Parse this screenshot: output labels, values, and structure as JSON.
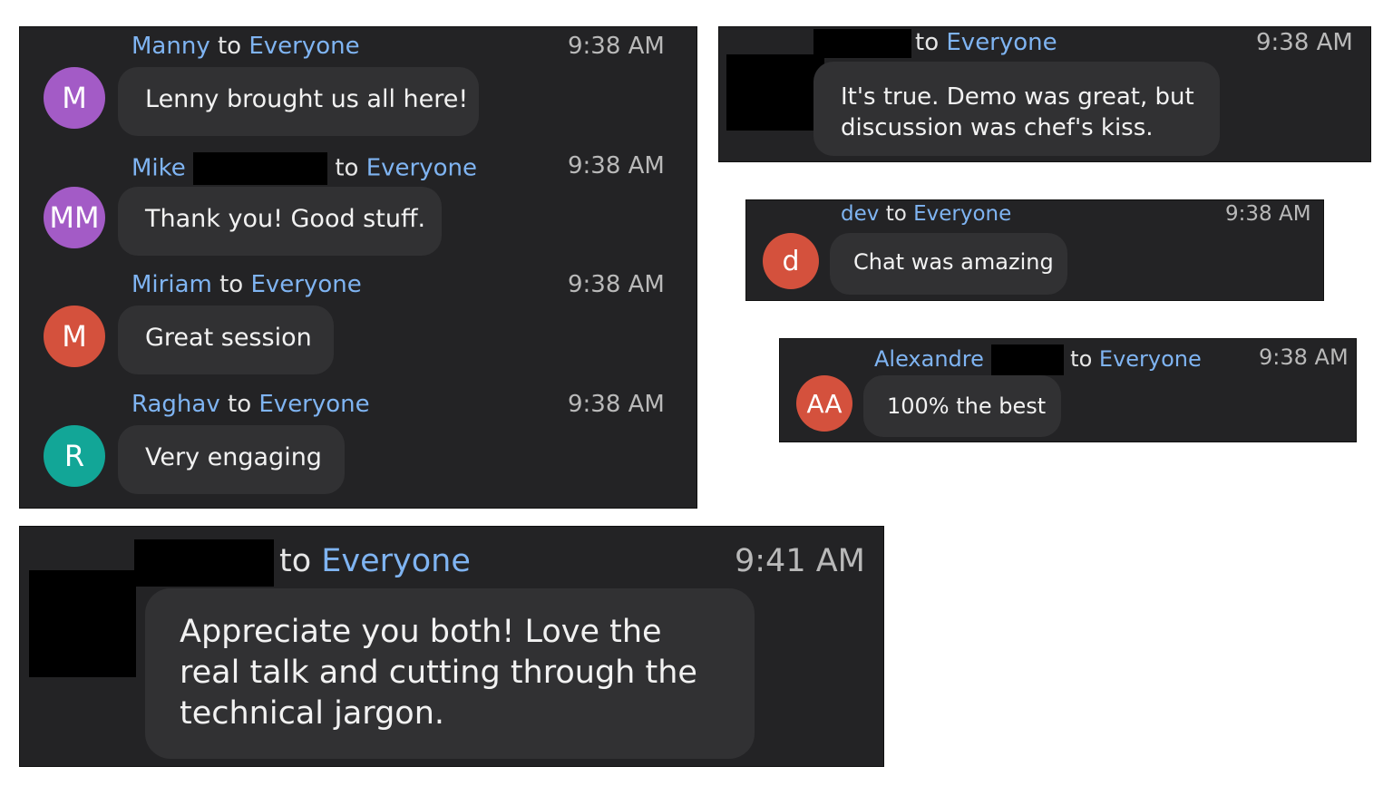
{
  "colors": {
    "panel_bg": "#232325",
    "bubble_bg": "#313133",
    "link_blue": "#7fb4f2",
    "avatar_purple": "#a35bc6",
    "avatar_red": "#d4513d",
    "avatar_teal": "#12a697"
  },
  "to_label": "to",
  "recipient": "Everyone",
  "messages": [
    {
      "sender": "Manny",
      "avatar": "M",
      "time": "9:38 AM",
      "text": "Lenny brought us all here!"
    },
    {
      "sender": "Mike",
      "avatar": "MM",
      "time": "9:38 AM",
      "text": "Thank you! Good stuff."
    },
    {
      "sender": "Miriam",
      "avatar": "M",
      "time": "9:38 AM",
      "text": "Great session"
    },
    {
      "sender": "Raghav",
      "avatar": "R",
      "time": "9:38 AM",
      "text": "Very engaging"
    },
    {
      "sender": "",
      "avatar": "",
      "time": "9:38 AM",
      "text": "It's true. Demo was great, but discussion was chef's kiss."
    },
    {
      "sender": "dev",
      "avatar": "d",
      "time": "9:38 AM",
      "text": "Chat was amazing"
    },
    {
      "sender": "Alexandre",
      "avatar": "AA",
      "time": "9:38 AM",
      "text": "100% the best"
    },
    {
      "sender": "",
      "avatar": "",
      "time": "9:41 AM",
      "text": "Appreciate you both! Love the real talk and cutting through the technical jargon."
    }
  ]
}
